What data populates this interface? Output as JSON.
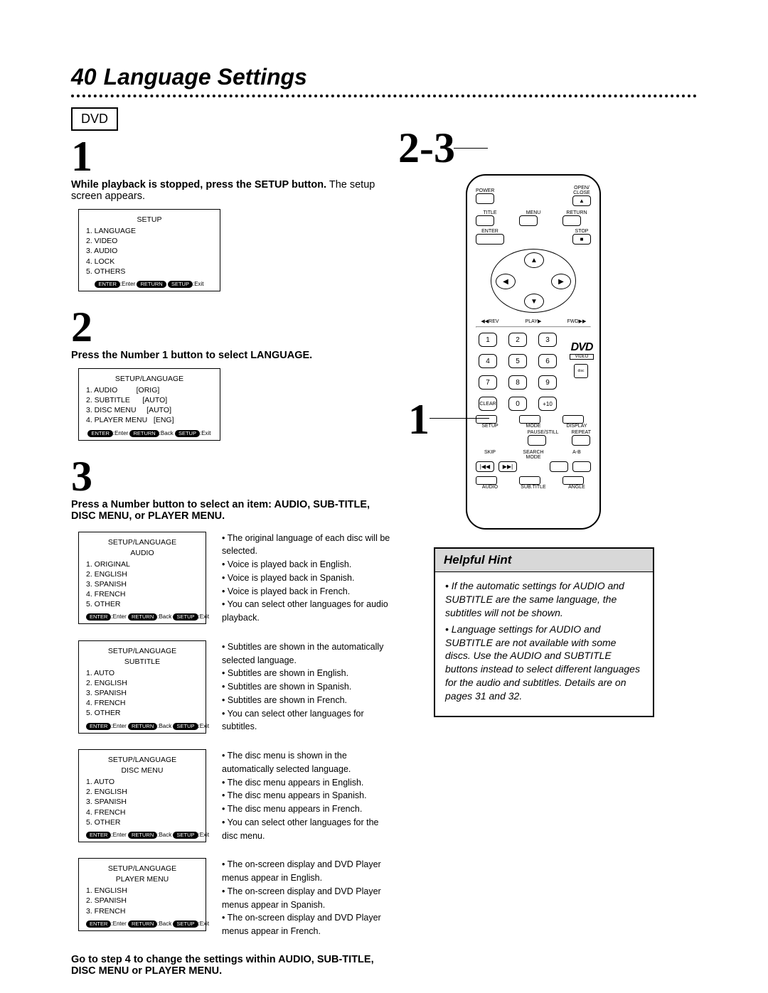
{
  "page_number": "40",
  "title": "Language Settings",
  "dvd_label": "DVD",
  "steps": {
    "s1": {
      "num": "1",
      "text_bold": "While playback is stopped, press the SETUP button.",
      "text_rest": " The setup screen appears.",
      "box": {
        "title": "SETUP",
        "rows": [
          "1. LANGUAGE",
          "2. VIDEO",
          "3. AUDIO",
          "4. LOCK",
          "5. OTHERS"
        ],
        "foot_pills": [
          "ENTER",
          "RETURN",
          "SETUP"
        ],
        "foot_words": [
          ":Enter",
          "",
          ":Exit"
        ]
      }
    },
    "s2": {
      "num": "2",
      "text_bold": "Press the Number 1 button to select LANGUAGE.",
      "box": {
        "title": "SETUP/LANGUAGE",
        "rows": [
          "1. AUDIO         [ORIG]",
          "2. SUBTITLE      [AUTO]",
          "3. DISC MENU     [AUTO]",
          "4. PLAYER MENU   [ENG]"
        ],
        "foot_pills": [
          "ENTER",
          "RETURN",
          "SETUP"
        ],
        "foot_words": [
          ":Enter",
          ":Back",
          ":Exit"
        ]
      }
    },
    "s3": {
      "num": "3",
      "text_bold": "Press a Number button to select an item: AUDIO, SUB-TITLE, DISC MENU, or PLAYER MENU.",
      "groups": [
        {
          "box": {
            "title": "SETUP/LANGUAGE",
            "sub": "AUDIO",
            "rows": [
              "1. ORIGINAL",
              "2. ENGLISH",
              "3. SPANISH",
              "4. FRENCH",
              "5. OTHER"
            ]
          },
          "desc": [
            "The original language of each disc will be selected.",
            "Voice is played back in English.",
            "Voice is played back in Spanish.",
            "Voice is played back in French.",
            "You can select other languages for audio playback."
          ]
        },
        {
          "box": {
            "title": "SETUP/LANGUAGE",
            "sub": "SUBTITLE",
            "rows": [
              "1. AUTO",
              "2. ENGLISH",
              "3. SPANISH",
              "4. FRENCH",
              "5. OTHER"
            ]
          },
          "desc": [
            "Subtitles are shown in the automatically selected language.",
            "Subtitles are shown in English.",
            "Subtitles are shown in Spanish.",
            "Subtitles are shown in French.",
            "You can select other languages for subtitles."
          ]
        },
        {
          "box": {
            "title": "SETUP/LANGUAGE",
            "sub": "DISC MENU",
            "rows": [
              "1. AUTO",
              "2. ENGLISH",
              "3. SPANISH",
              "4. FRENCH",
              "5. OTHER"
            ]
          },
          "desc": [
            "The disc menu is shown in the automatically selected language.",
            "The disc menu appears in English.",
            "The disc menu appears in Spanish.",
            "The disc menu appears in French.",
            "You can select other languages for the disc menu."
          ]
        },
        {
          "box": {
            "title": "SETUP/LANGUAGE",
            "sub": "PLAYER MENU",
            "rows": [
              "1. ENGLISH",
              "2. SPANISH",
              "3. FRENCH"
            ]
          },
          "desc": [
            "The on-screen display and DVD Player menus appear in English.",
            "The on-screen display and DVD Player menus appear in Spanish.",
            "The on-screen display and DVD Player menus appear in French."
          ]
        }
      ],
      "footer_bold": "Go to step 4 to change the settings within AUDIO, SUB-TITLE, DISC MENU or PLAYER MENU."
    }
  },
  "right": {
    "label_23": "2-3",
    "label_1": "1"
  },
  "remote": {
    "power": "POWER",
    "open_close": "OPEN/\nCLOSE",
    "title": "TITLE",
    "menu": "MENU",
    "return": "RETURN",
    "enter": "ENTER",
    "stop": "STOP",
    "stop_sym": "■",
    "rev": "◀◀REV",
    "play": "PLAY▶",
    "fwd": "FWD▶▶",
    "nums": [
      "1",
      "2",
      "3",
      "4",
      "5",
      "6",
      "7",
      "8",
      "9"
    ],
    "clear": "CLEAR",
    "zero": "0",
    "plus10": "+10",
    "setup": "SETUP",
    "mode": "MODE",
    "display": "DISPLAY",
    "pause": "PAUSE/STILL",
    "repeat": "REPEAT",
    "skip": "SKIP",
    "search": "SEARCH MODE",
    "ab": "A-B",
    "skip_l": "|◀◀",
    "skip_r": "▶▶|",
    "audio": "AUDIO",
    "subtitle": "SUB.TITLE",
    "angle": "ANGLE",
    "dvd_brand": "DVD",
    "dvd_sub": "VIDEO"
  },
  "hint": {
    "title": "Helpful Hint",
    "items": [
      "If the automatic settings for AUDIO and SUBTITLE are the same language, the subtitles will not be shown.",
      "Language settings for AUDIO and SUBTITLE are not available with some discs. Use the AUDIO and SUBTITLE buttons instead to select different languages for the audio and subtitles. Details are on pages 31 and 32."
    ]
  }
}
